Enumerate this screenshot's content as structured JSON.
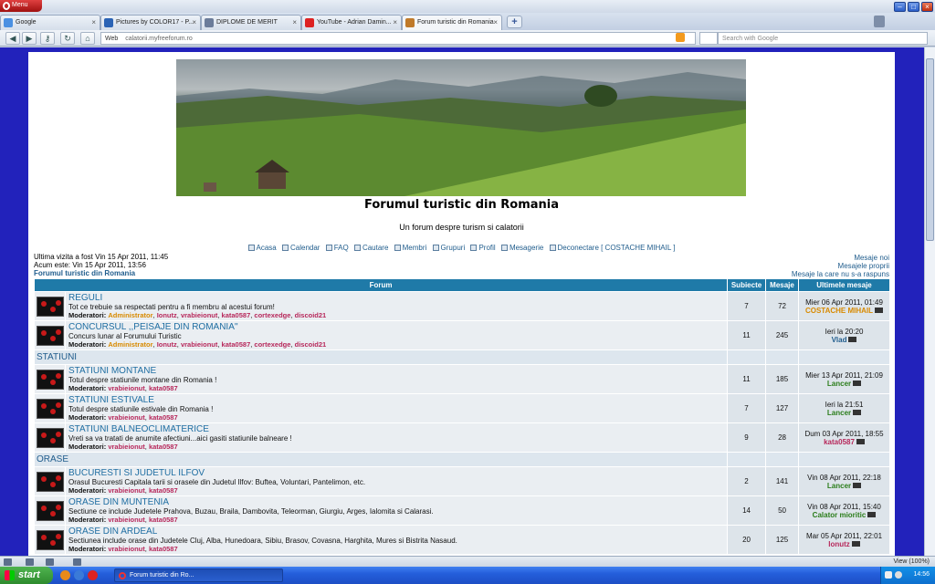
{
  "browser": {
    "menu_label": "Menu",
    "tabs": [
      {
        "label": "Google",
        "color": "#4a90e2"
      },
      {
        "label": "Pictures by COLOR17 - P...",
        "color": "#2a63b5"
      },
      {
        "label": "DIPLOME DE MERIT",
        "color": "#6b7c9a"
      },
      {
        "label": "YouTube - Adrian Damin...",
        "color": "#d22"
      },
      {
        "label": "Forum turistic din Romania",
        "color": "#c07a2a"
      }
    ],
    "address": {
      "web_label": "Web",
      "url": "calatorii.myfreeforum.ro"
    },
    "search_placeholder": "Search with Google",
    "zoom": "View (100%)"
  },
  "forum": {
    "title": "Forumul turistic din Romania",
    "description": "Un forum despre turism si calatorii",
    "nav": [
      {
        "label": "Acasa"
      },
      {
        "label": "Calendar"
      },
      {
        "label": "FAQ"
      },
      {
        "label": "Cautare"
      },
      {
        "label": "Membri"
      },
      {
        "label": "Grupuri"
      },
      {
        "label": "Profil"
      },
      {
        "label": "Mesagerie"
      },
      {
        "label": "Deconectare [ COSTACHE MIHAIL ]"
      }
    ],
    "last_visit": "Ultima vizita a fost Vin 15 Apr 2011, 11:45",
    "now": "Acum este: Vin 15 Apr 2011, 13:56",
    "breadcrumb": "Forumul turistic din Romania",
    "right_links": [
      "Mesaje noi",
      "Mesajele proprii",
      "Mesaje la care nu s-a raspuns"
    ],
    "table_headers": {
      "forum": "Forum",
      "topics": "Subiecte",
      "posts": "Mesaje",
      "last": "Ultimele mesaje"
    },
    "moderators_label": "Moderatori:",
    "groups": [
      {
        "category": "",
        "forums": [
          {
            "name": "REGULI",
            "desc": "Tot ce trebuie sa respectati pentru a fi membru al acestui forum!",
            "mods": [
              "Administrator",
              "Ionutz",
              "vrabieionut",
              "kata0587",
              "cortexedge",
              "discoid21"
            ],
            "topics": "7",
            "posts": "72",
            "last_date": "Mier 06 Apr 2011, 01:49",
            "last_user": "COSTACHE MIHAIL",
            "last_user_color": "orange"
          },
          {
            "name": "CONCURSUL ,,PEISAJE DIN ROMANIA''",
            "desc": "Concurs lunar al Forumului Turistic",
            "mods": [
              "Administrator",
              "Ionutz",
              "vrabieionut",
              "kata0587",
              "cortexedge",
              "discoid21"
            ],
            "topics": "11",
            "posts": "245",
            "last_date": "Ieri la 20:20",
            "last_user": "Vlad",
            "last_user_color": "blue"
          }
        ]
      },
      {
        "category": "STATIUNI",
        "forums": [
          {
            "name": "STATIUNI MONTANE",
            "desc": "Totul despre statiunile montane din Romania !",
            "mods": [
              "vrabieionut",
              "kata0587"
            ],
            "topics": "11",
            "posts": "185",
            "last_date": "Mier 13 Apr 2011, 21:09",
            "last_user": "Lancer",
            "last_user_color": "green"
          },
          {
            "name": "STATIUNI ESTIVALE",
            "desc": "Totul despre statiunile estivale din Romania !",
            "mods": [
              "vrabieionut",
              "kata0587"
            ],
            "topics": "7",
            "posts": "127",
            "last_date": "Ieri la 21:51",
            "last_user": "Lancer",
            "last_user_color": "green"
          },
          {
            "name": "STATIUNI BALNEOCLIMATERICE",
            "desc": "Vreti sa va tratati de anumite afectiuni...aici gasiti statiunile balneare !",
            "mods": [
              "vrabieionut",
              "kata0587"
            ],
            "topics": "9",
            "posts": "28",
            "last_date": "Dum 03 Apr 2011, 18:55",
            "last_user": "kata0587",
            "last_user_color": "red"
          }
        ]
      },
      {
        "category": "ORASE",
        "forums": [
          {
            "name": "BUCURESTI SI JUDETUL ILFOV",
            "desc": "Orasul Bucuresti Capitala tarii si orasele din Judetul Ilfov: Buftea, Voluntari, Pantelimon, etc.",
            "mods": [
              "vrabieionut",
              "kata0587"
            ],
            "topics": "2",
            "posts": "141",
            "last_date": "Vin 08 Apr 2011, 22:18",
            "last_user": "Lancer",
            "last_user_color": "green"
          },
          {
            "name": "ORASE DIN MUNTENIA",
            "desc": "Sectiune ce include Judetele Prahova, Buzau, Braila, Dambovita, Teleorman, Giurgiu, Arges, Ialomita si Calarasi.",
            "mods": [
              "vrabieionut",
              "kata0587"
            ],
            "topics": "14",
            "posts": "50",
            "last_date": "Vin 08 Apr 2011, 15:40",
            "last_user": "Calator mioritic",
            "last_user_color": "green"
          },
          {
            "name": "ORASE DIN ARDEAL",
            "desc": "Sectiunea include orase din Judetele Cluj, Alba, Hunedoara, Sibiu, Brasov, Covasna, Harghita, Mures si Bistrita Nasaud.",
            "mods": [
              "vrabieionut",
              "kata0587"
            ],
            "topics": "20",
            "posts": "125",
            "last_date": "Mar 05 Apr 2011, 22:01",
            "last_user": "Ionutz",
            "last_user_color": "red"
          }
        ]
      }
    ]
  },
  "taskbar": {
    "start_label": "start",
    "task_item": "Forum turistic din Ro...",
    "clock": "14:56"
  }
}
